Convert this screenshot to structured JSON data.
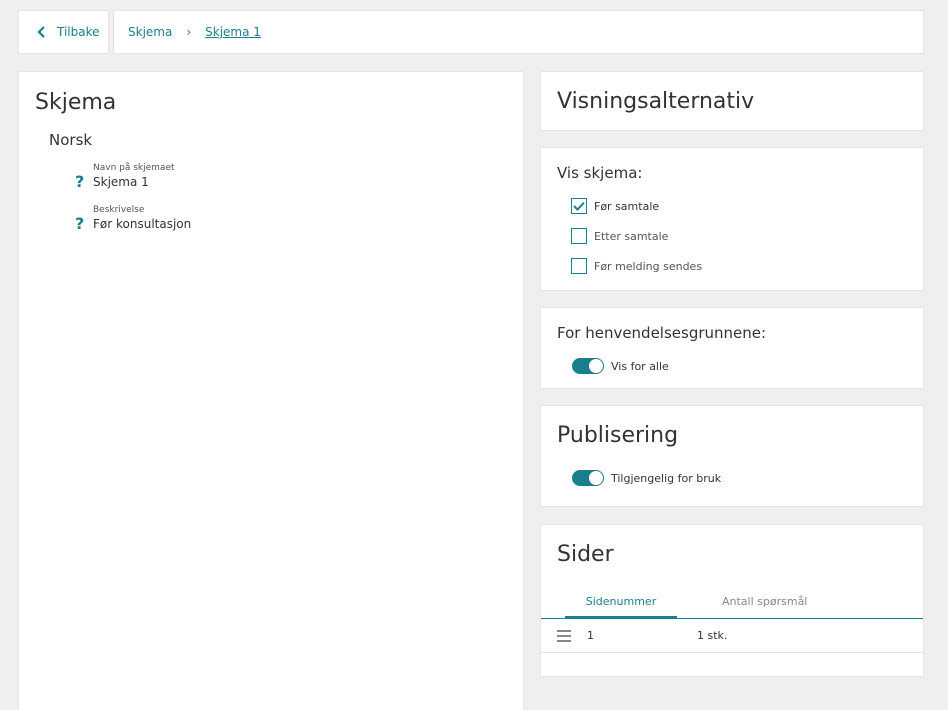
{
  "topbar": {
    "back_label": "Tilbake",
    "breadcrumb": {
      "parent": "Skjema",
      "current": "Skjema 1"
    }
  },
  "main": {
    "title": "Skjema",
    "language": "Norsk",
    "fields": [
      {
        "label": "Navn på skjemaet",
        "value": "Skjema 1"
      },
      {
        "label": "Beskrivelse",
        "value": "Før konsultasjon"
      }
    ]
  },
  "options": {
    "title": "Visningsalternativ"
  },
  "vis": {
    "title": "Vis skjema:",
    "options": [
      {
        "label": "Før samtale",
        "checked": true
      },
      {
        "label": "Etter samtale",
        "checked": false
      },
      {
        "label": "Før melding sendes",
        "checked": false
      }
    ]
  },
  "henvendelse": {
    "title": "For henvendelsesgrunnene:",
    "toggle_label": "Vis for alle",
    "on": true
  },
  "publisering": {
    "title": "Publisering",
    "toggle_label": "Tilgjengelig for bruk",
    "on": true
  },
  "sider": {
    "title": "Sider",
    "tabs": [
      "Sidenummer",
      "Antall spørsmål"
    ],
    "rows": [
      {
        "number": "1",
        "count": "1 stk."
      }
    ]
  },
  "colors": {
    "accent": "#1a7f8c",
    "background": "#efefef",
    "card": "#ffffff"
  }
}
